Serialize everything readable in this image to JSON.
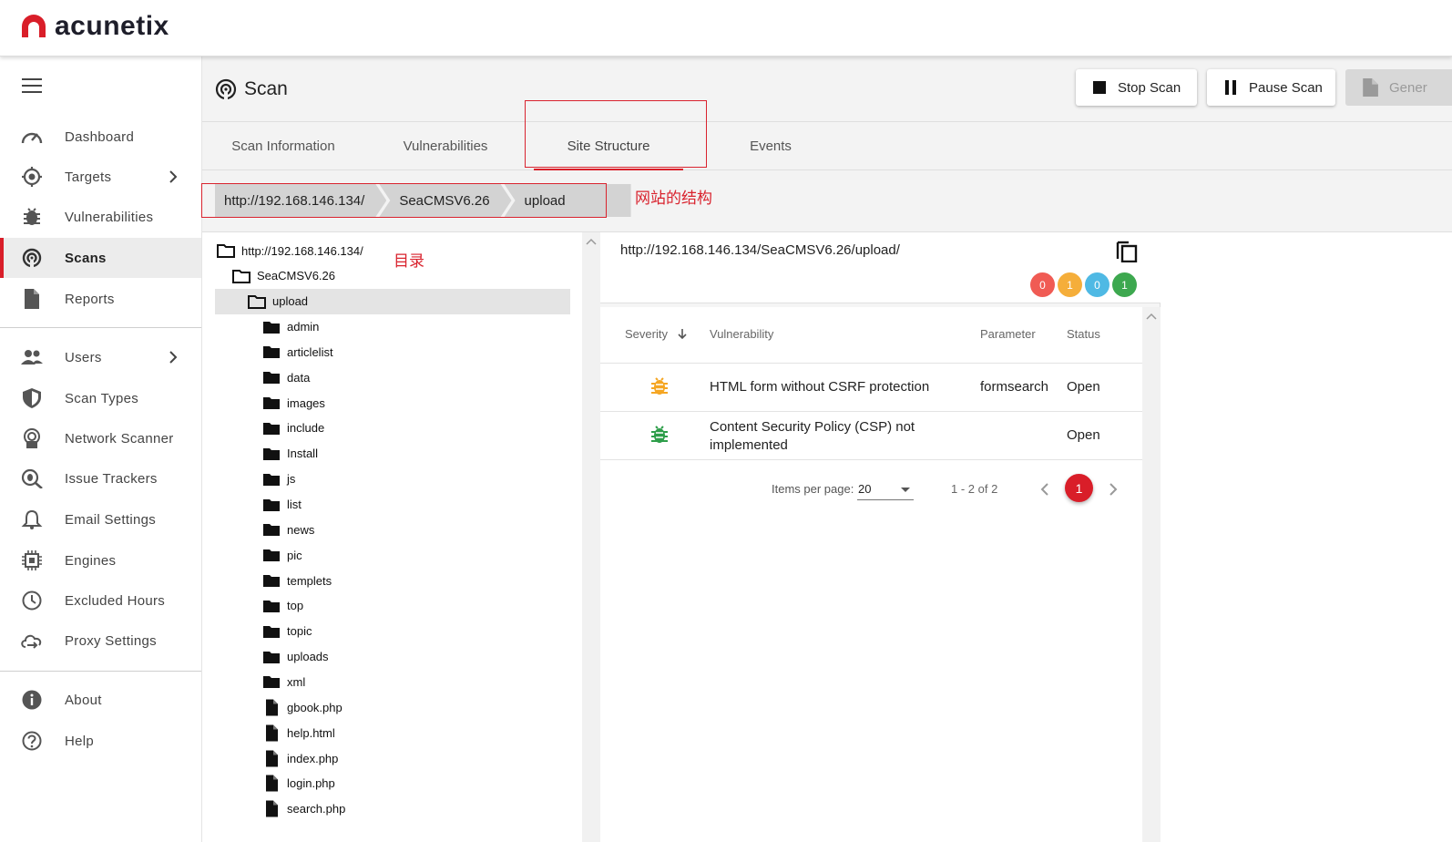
{
  "brand": {
    "name": "acunetix",
    "color": "#d91e29"
  },
  "sidebar": {
    "items": [
      {
        "label": "Dashboard",
        "icon": "dashboard-gauge-icon"
      },
      {
        "label": "Targets",
        "icon": "target-icon",
        "has_children": true
      },
      {
        "label": "Vulnerabilities",
        "icon": "bug-icon"
      },
      {
        "label": "Scans",
        "icon": "scan-radar-icon",
        "active": true
      },
      {
        "label": "Reports",
        "icon": "report-file-icon"
      },
      {
        "label": "Users",
        "icon": "users-icon",
        "has_children": true
      },
      {
        "label": "Scan Types",
        "icon": "shield-icon"
      },
      {
        "label": "Network Scanner",
        "icon": "network-scanner-icon"
      },
      {
        "label": "Issue Trackers",
        "icon": "issue-tracker-icon"
      },
      {
        "label": "Email Settings",
        "icon": "bell-icon"
      },
      {
        "label": "Engines",
        "icon": "chip-icon"
      },
      {
        "label": "Excluded Hours",
        "icon": "clock-icon"
      },
      {
        "label": "Proxy Settings",
        "icon": "cloud-proxy-icon"
      },
      {
        "label": "About",
        "icon": "info-icon"
      },
      {
        "label": "Help",
        "icon": "help-icon"
      }
    ]
  },
  "header": {
    "title": "Scan",
    "buttons": {
      "stop": "Stop Scan",
      "pause": "Pause Scan",
      "generate": "Gener"
    }
  },
  "tabs": [
    {
      "label": "Scan Information"
    },
    {
      "label": "Vulnerabilities"
    },
    {
      "label": "Site Structure",
      "active": true
    },
    {
      "label": "Events"
    }
  ],
  "breadcrumb": [
    "http://192.168.146.134/",
    "SeaCMSV6.26",
    "upload"
  ],
  "annotations": {
    "structure": "网站的结构",
    "directory": "目录"
  },
  "tree": {
    "root": "http://192.168.146.134/",
    "level1": "SeaCMSV6.26",
    "selected": "upload",
    "folders": [
      "admin",
      "articlelist",
      "data",
      "images",
      "include",
      "Install",
      "js",
      "list",
      "news",
      "pic",
      "templets",
      "top",
      "topic",
      "uploads",
      "xml"
    ],
    "files": [
      "gbook.php",
      "help.html",
      "index.php",
      "login.php",
      "search.php"
    ]
  },
  "detail": {
    "url": "http://192.168.146.134/SeaCMSV6.26/upload/",
    "severity_counts": [
      {
        "value": "0",
        "color": "#f05b54"
      },
      {
        "value": "1",
        "color": "#f5ae3a"
      },
      {
        "value": "0",
        "color": "#4fb9e4"
      },
      {
        "value": "1",
        "color": "#3da84f"
      }
    ],
    "columns": {
      "severity": "Severity",
      "vulnerability": "Vulnerability",
      "parameter": "Parameter",
      "status": "Status"
    },
    "rows": [
      {
        "severity_color": "#f5a623",
        "vulnerability": "HTML form without CSRF protection",
        "parameter": "formsearch",
        "status": "Open"
      },
      {
        "severity_color": "#2e9e4a",
        "vulnerability": "Content Security Policy (CSP) not implemented",
        "parameter": "",
        "status": "Open"
      }
    ],
    "pagination": {
      "items_per_page_label": "Items per page:",
      "items_per_page": "20",
      "range": "1 - 2 of 2",
      "current_page": "1"
    }
  }
}
